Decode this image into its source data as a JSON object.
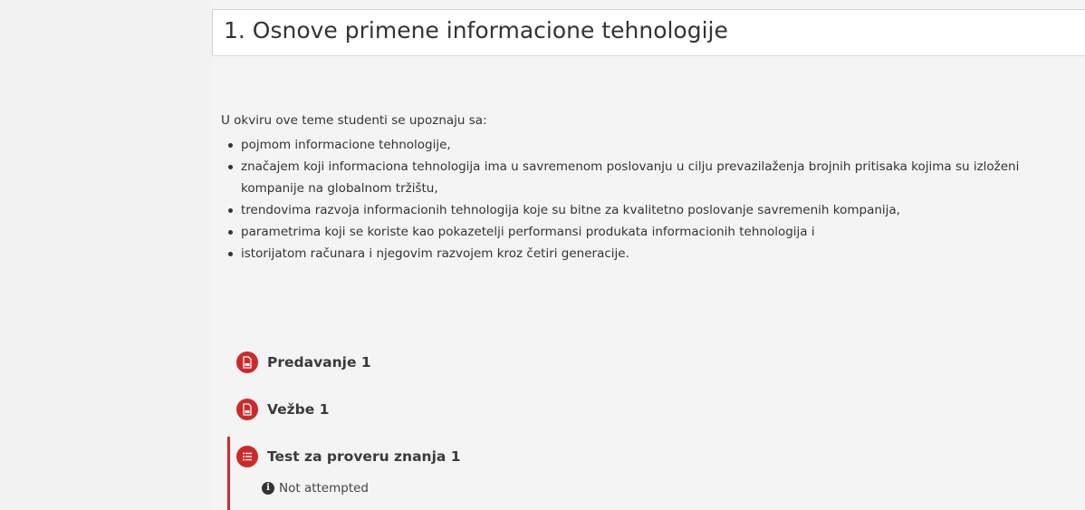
{
  "section": {
    "title": "1. Osnove primene informacione tehnologije",
    "intro": "U okviru ove teme studenti se upoznaju sa:",
    "topics": [
      "pojmom informacione tehnologije,",
      "značajem koji informaciona tehnologija ima u savremenom poslovanju u cilju prevazilaženja brojnih pritisaka kojima su izloženi",
      "kompanije na globalnom tržištu,",
      "trendovima razvoja informacionih tehnologija koje su bitne za kvalitetno poslovanje savremenih kompanija,",
      "parametrima koji se koriste kao pokazetelji performansi produkata informacionih tehnologija i",
      "istorijatom računara i njegovim razvojem kroz četiri generacije."
    ]
  },
  "activities": [
    {
      "label": "Predavanje 1",
      "icon": "pdf-icon"
    },
    {
      "label": "Vežbe 1",
      "icon": "pdf-icon"
    },
    {
      "label": "Test za proveru znanja 1",
      "icon": "quiz-icon",
      "status": "Not attempted",
      "status_icon": "info-icon"
    }
  ],
  "colors": {
    "accent": "#cc2a2a",
    "quiz_bar": "#d9232d",
    "panel_bg": "#f4f4f4",
    "text": "#333333"
  }
}
